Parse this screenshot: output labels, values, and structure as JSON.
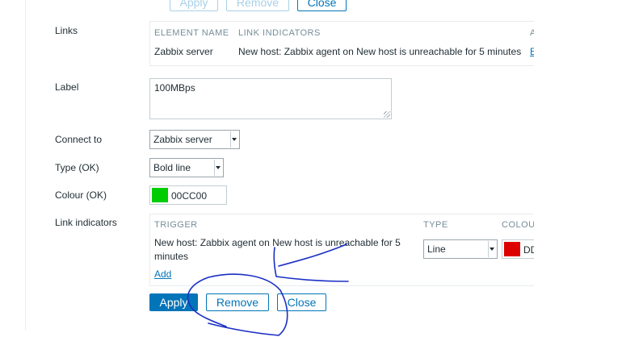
{
  "top_buttons": {
    "apply": "Apply",
    "remove": "Remove",
    "close": "Close"
  },
  "links": {
    "label": "Links",
    "headers": {
      "element_name": "ELEMENT NAME",
      "link_indicators": "LINK INDICATORS",
      "cut": "A"
    },
    "row": {
      "element_name": "Zabbix server",
      "link_indicators": "New host: Zabbix agent on New host is unreachable for 5 minutes",
      "cut": "E"
    }
  },
  "label_field": {
    "label": "Label",
    "value": "100MBps"
  },
  "connect_to": {
    "label": "Connect to",
    "value": "Zabbix server"
  },
  "type_ok": {
    "label": "Type (OK)",
    "value": "Bold line"
  },
  "colour_ok": {
    "label": "Colour (OK)",
    "value": "00CC00",
    "color": "#00cc00"
  },
  "link_indicators": {
    "label": "Link indicators",
    "headers": {
      "trigger": "TRIGGER",
      "type": "TYPE",
      "colour": "COLOU"
    },
    "row": {
      "trigger_line1": "New host: Zabbix agent on New host is unreachable for 5",
      "trigger_line2": "minutes",
      "type": "Line",
      "colour_value": "DD",
      "colour": "#dd0000"
    },
    "add": "Add"
  },
  "bottom_buttons": {
    "apply": "Apply",
    "remove": "Remove",
    "close": "Close"
  },
  "colors": {
    "accent": "#0275b8",
    "annotation_ink": "#1a2fc4"
  }
}
